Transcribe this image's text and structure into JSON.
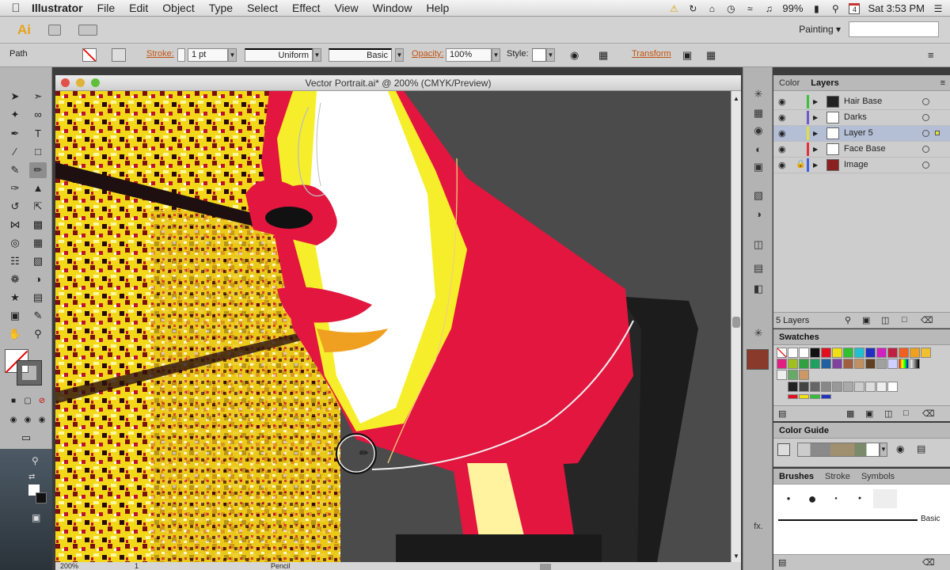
{
  "menubar": {
    "app_name": "Illustrator",
    "menus": [
      "File",
      "Edit",
      "Object",
      "Type",
      "Select",
      "Effect",
      "View",
      "Window",
      "Help"
    ],
    "battery": "99%",
    "calendar_day": "4",
    "clock": "Sat 3:53 PM"
  },
  "appbar": {
    "logo": "Ai",
    "workspace": "Painting"
  },
  "control": {
    "selection_type": "Path",
    "stroke_label": "Stroke:",
    "stroke_weight": "1 pt",
    "profile": "Uniform",
    "brush": "Basic",
    "opacity_label": "Opacity:",
    "opacity_value": "100%",
    "style_label": "Style:",
    "transform_label": "Transform"
  },
  "document": {
    "title": "Vector Portrait.ai* @ 200% (CMYK/Preview)",
    "zoom": "200%",
    "artboard": "1",
    "status": "Pencil"
  },
  "layers_panel": {
    "tabs": [
      "Color",
      "Layers"
    ],
    "active_tab": "Layers",
    "layers": [
      {
        "name": "Hair Base",
        "color": "#3fbf3f",
        "locked": false,
        "selected": false
      },
      {
        "name": "Darks",
        "color": "#6a5acd",
        "locked": false,
        "selected": false
      },
      {
        "name": "Layer 5",
        "color": "#e0e040",
        "locked": false,
        "selected": true
      },
      {
        "name": "Face Base",
        "color": "#e03040",
        "locked": false,
        "selected": false
      },
      {
        "name": "Image",
        "color": "#4060e0",
        "locked": true,
        "selected": false
      }
    ],
    "count_label": "5 Layers"
  },
  "swatches_panel": {
    "title": "Swatches"
  },
  "color_guide_panel": {
    "title": "Color Guide"
  },
  "brushes_panel": {
    "tabs": [
      "Brushes",
      "Stroke",
      "Symbols"
    ],
    "active_tab": "Brushes",
    "basic_label": "Basic"
  },
  "colors": {
    "accent_orange": "#c2530f",
    "art_red": "#e0163f",
    "art_yellow": "#f5e61a"
  }
}
